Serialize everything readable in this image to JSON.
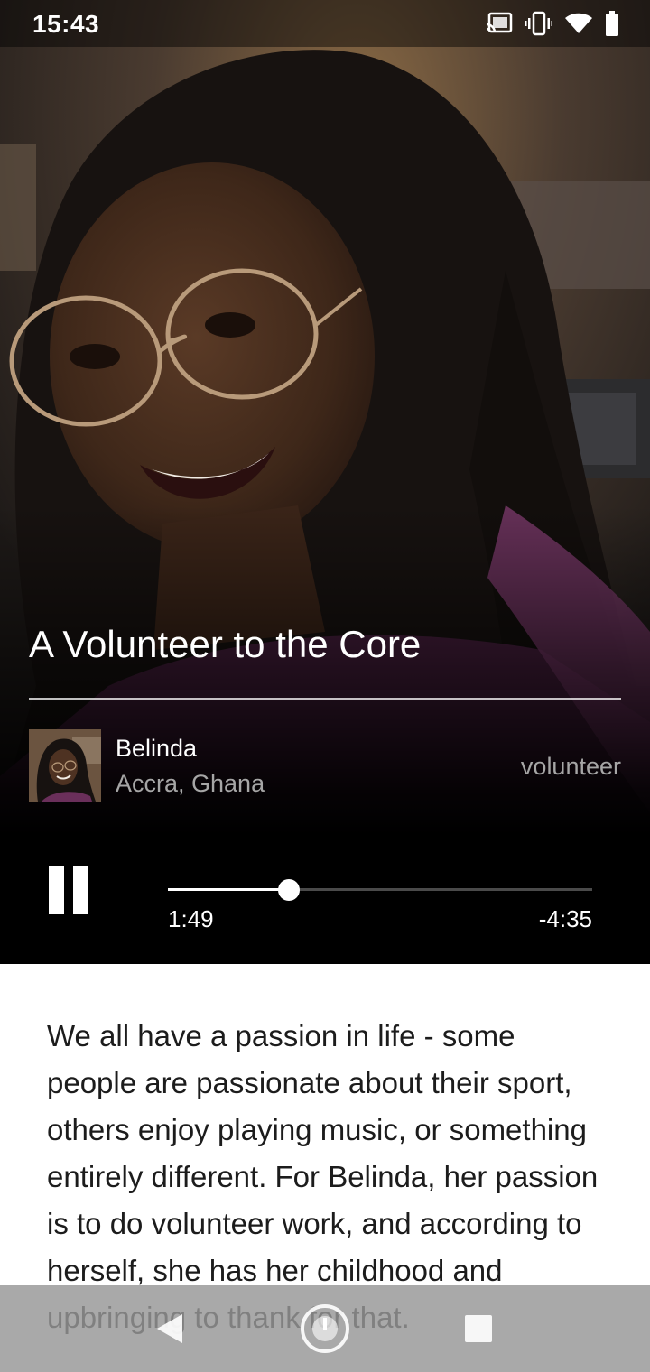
{
  "status_bar": {
    "time": "15:43",
    "icons": [
      "cast-icon",
      "vibrate-icon",
      "wifi-icon",
      "battery-icon"
    ]
  },
  "story": {
    "title": "A Volunteer to the Core"
  },
  "profile": {
    "name": "Belinda",
    "location": "Accra, Ghana",
    "tag": "volunteer"
  },
  "player": {
    "state": "playing",
    "control_icon": "pause-icon",
    "elapsed": "1:49",
    "remaining": "-4:35",
    "progress": 0.285
  },
  "article": {
    "text": "We all have a passion in life - some people are passionate about their sport, others enjoy playing music, or something entirely different. For Belinda, her passion is to do volunteer work, and according to herself, she has her childhood and upbringing to thank for that."
  },
  "nav_bar": {
    "icons": [
      "back-icon",
      "home-icon",
      "recents-icon"
    ]
  },
  "colors": {
    "player_background": "#000000",
    "secondary_text": "#a6a6a6",
    "article_text": "#1c1c1c",
    "nav_bar": "#969696"
  }
}
